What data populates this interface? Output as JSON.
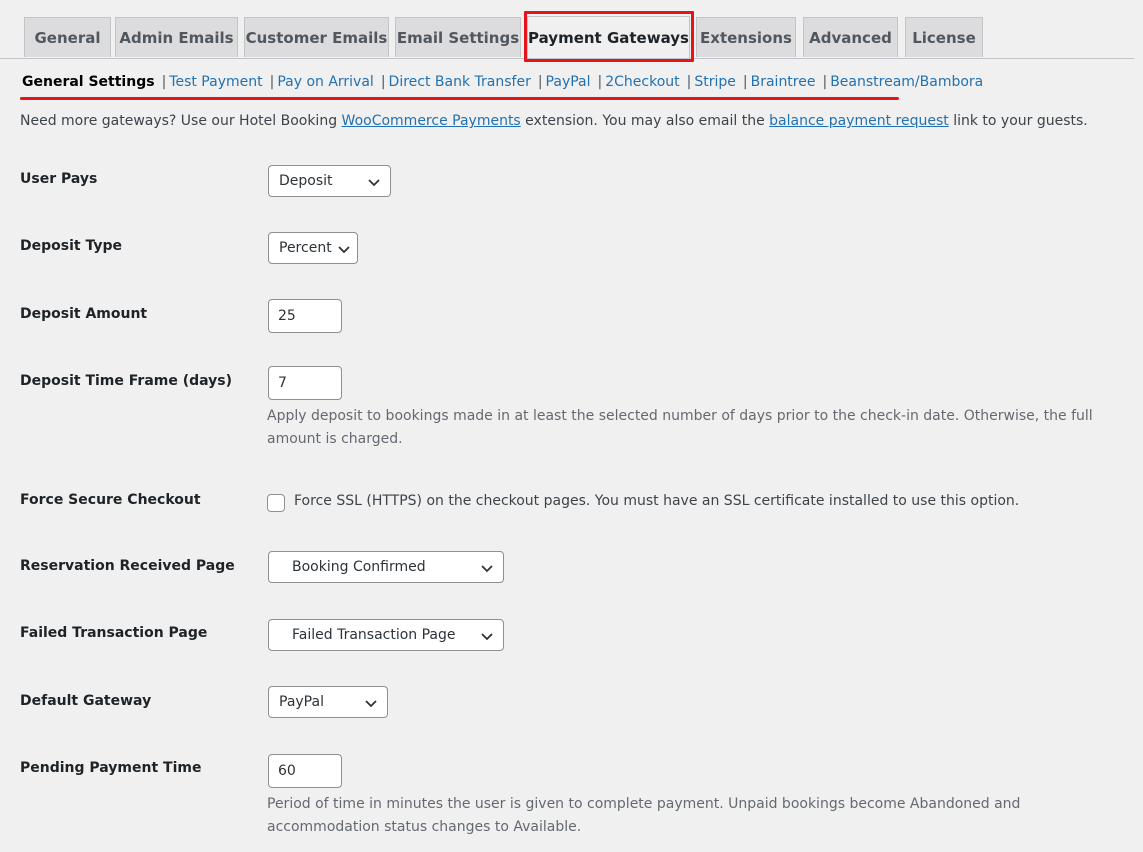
{
  "tabs": [
    {
      "label": "General"
    },
    {
      "label": "Admin Emails"
    },
    {
      "label": "Customer Emails"
    },
    {
      "label": "Email Settings"
    },
    {
      "label": "Payment Gateways"
    },
    {
      "label": "Extensions"
    },
    {
      "label": "Advanced"
    },
    {
      "label": "License"
    }
  ],
  "subnav": [
    {
      "label": "General Settings"
    },
    {
      "label": "Test Payment"
    },
    {
      "label": "Pay on Arrival"
    },
    {
      "label": "Direct Bank Transfer"
    },
    {
      "label": "PayPal"
    },
    {
      "label": "2Checkout"
    },
    {
      "label": "Stripe"
    },
    {
      "label": "Braintree"
    },
    {
      "label": "Beanstream/Bambora"
    }
  ],
  "subnav_separator": "|",
  "notice": {
    "prefix": "Need more gateways? Use our Hotel Booking ",
    "link1": "WooCommerce Payments",
    "middle": " extension. You may also email the ",
    "link2": "balance payment request",
    "suffix": " link to your guests."
  },
  "fields": {
    "user_pays": {
      "label": "User Pays",
      "value": "Deposit"
    },
    "deposit_type": {
      "label": "Deposit Type",
      "value": "Percent"
    },
    "deposit_amount": {
      "label": "Deposit Amount",
      "value": "25"
    },
    "deposit_time_frame": {
      "label": "Deposit Time Frame (days)",
      "value": "7",
      "desc_line1": "Apply deposit to bookings made in at least the selected number of days prior to the check-in date. Otherwise, the full",
      "desc_line2": "amount is charged."
    },
    "force_secure": {
      "label": "Force Secure Checkout",
      "checkbox_label": "Force SSL (HTTPS) on the checkout pages. You must have an SSL certificate installed to use this option.",
      "checked": false
    },
    "reservation_page": {
      "label": "Reservation Received Page",
      "value": "Booking Confirmed"
    },
    "failed_page": {
      "label": "Failed Transaction Page",
      "value": "Failed Transaction Page"
    },
    "default_gateway": {
      "label": "Default Gateway",
      "value": "PayPal"
    },
    "pending_time": {
      "label": "Pending Payment Time",
      "value": "60",
      "desc_line1": "Period of time in minutes the user is given to complete payment. Unpaid bookings become Abandoned and",
      "desc_line2": "accommodation status changes to Available."
    }
  },
  "colors": {
    "highlight": "#e4141b",
    "link": "#2271b1",
    "background": "#f0f0f1"
  }
}
